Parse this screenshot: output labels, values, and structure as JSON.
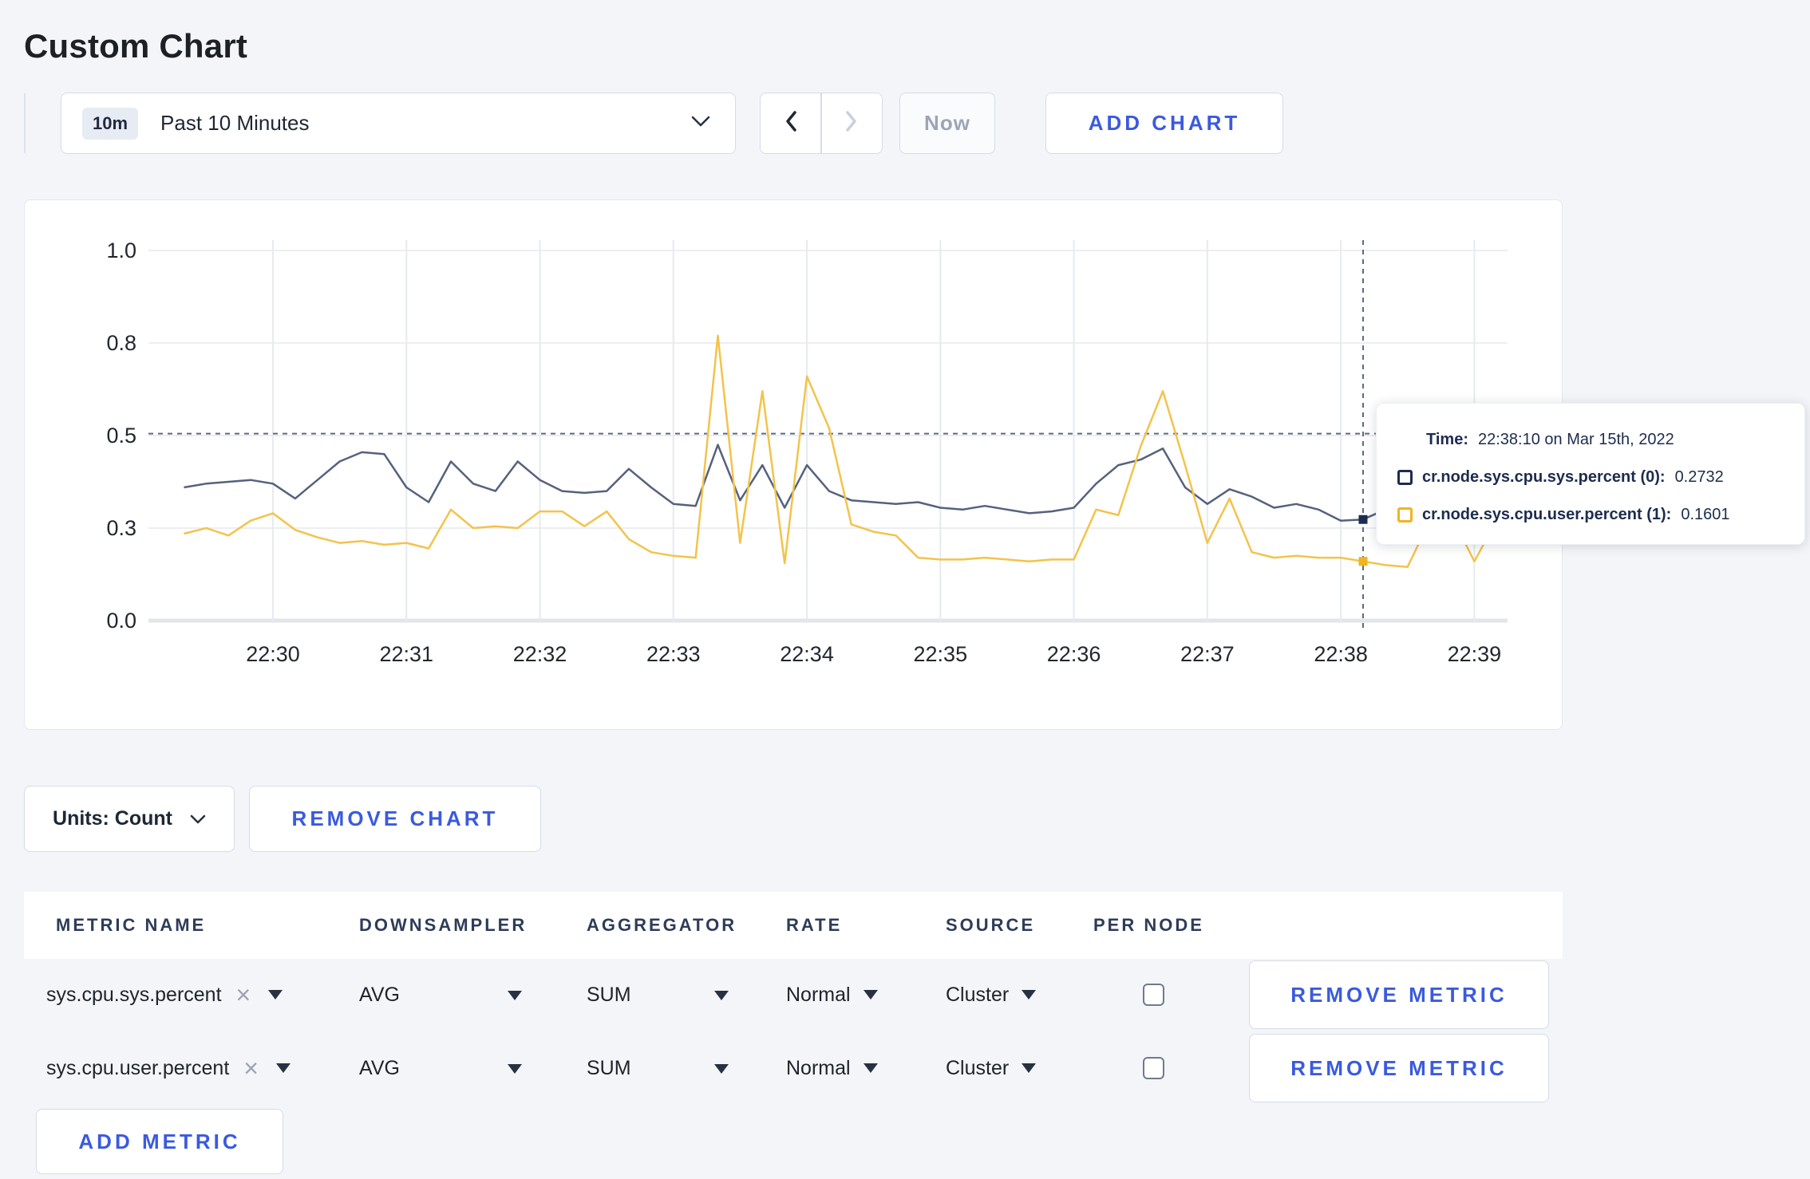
{
  "page": {
    "title": "Custom Chart"
  },
  "colors": {
    "accent_blue": "#3a5adf",
    "navy_text": "#1d2c4e",
    "page_background": "#f4f5f9",
    "series_sys_line": "#55627d",
    "series_user_line": "#f3c34a"
  },
  "toolbar": {
    "time_range_badge": "10m",
    "time_range_label": "Past 10 Minutes",
    "now_label": "Now",
    "add_chart_label": "ADD CHART"
  },
  "tooltip": {
    "time_label": "Time:",
    "time_value": "22:38:10 on Mar 15th, 2022",
    "series": [
      {
        "name": "cr.node.sys.cpu.sys.percent (0):",
        "value": "0.2732",
        "swatch_color": "#1d2c4e"
      },
      {
        "name": "cr.node.sys.cpu.user.percent (1):",
        "value": "0.1601",
        "swatch_color": "#f0b420"
      }
    ]
  },
  "chart_controls": {
    "units_label": "Units: Count",
    "remove_chart_label": "REMOVE CHART"
  },
  "metrics_table": {
    "headers": [
      "METRIC NAME",
      "DOWNSAMPLER",
      "AGGREGATOR",
      "RATE",
      "SOURCE",
      "PER NODE"
    ],
    "rows": [
      {
        "metric": "sys.cpu.sys.percent",
        "clear_icon": "×",
        "downsampler": "AVG",
        "aggregator": "SUM",
        "rate": "Normal",
        "source": "Cluster",
        "per_node_checked": false,
        "remove_label": "REMOVE METRIC"
      },
      {
        "metric": "sys.cpu.user.percent",
        "clear_icon": "×",
        "downsampler": "AVG",
        "aggregator": "SUM",
        "rate": "Normal",
        "source": "Cluster",
        "per_node_checked": false,
        "remove_label": "REMOVE METRIC"
      }
    ],
    "add_metric_label": "ADD METRIC"
  },
  "chart_data": {
    "type": "line",
    "title": "",
    "xlabel": "",
    "ylabel": "",
    "x_start": "22:29:20",
    "x_interval_seconds": 10,
    "x_tick_labels": [
      "22:30",
      "22:31",
      "22:32",
      "22:33",
      "22:34",
      "22:35",
      "22:36",
      "22:37",
      "22:38",
      "22:39"
    ],
    "x_first_tick_index": 4,
    "x_tick_every": 6,
    "y_ticks": [
      {
        "value": 0.0,
        "label": "0.0"
      },
      {
        "value": 0.25,
        "label": "0.3"
      },
      {
        "value": 0.5,
        "label": "0.5"
      },
      {
        "value": 0.75,
        "label": "0.8"
      },
      {
        "value": 1.0,
        "label": "1.0"
      }
    ],
    "ylim": [
      0,
      1
    ],
    "grid": true,
    "legend_position": "tooltip",
    "series": [
      {
        "name": "cr.node.sys.cpu.sys.percent",
        "color": "#55627d",
        "values": [
          0.36,
          0.37,
          0.375,
          0.38,
          0.37,
          0.33,
          0.38,
          0.43,
          0.455,
          0.45,
          0.36,
          0.32,
          0.43,
          0.37,
          0.35,
          0.43,
          0.38,
          0.35,
          0.345,
          0.35,
          0.41,
          0.36,
          0.315,
          0.31,
          0.475,
          0.325,
          0.42,
          0.305,
          0.42,
          0.35,
          0.325,
          0.32,
          0.315,
          0.32,
          0.305,
          0.3,
          0.31,
          0.3,
          0.29,
          0.295,
          0.305,
          0.37,
          0.42,
          0.435,
          0.465,
          0.36,
          0.315,
          0.355,
          0.335,
          0.305,
          0.315,
          0.3,
          0.27,
          0.2732,
          0.3,
          0.305,
          0.3,
          0.31,
          0.3,
          0.315
        ]
      },
      {
        "name": "cr.node.sys.cpu.user.percent",
        "color": "#f3c34a",
        "values": [
          0.235,
          0.25,
          0.23,
          0.27,
          0.29,
          0.245,
          0.225,
          0.21,
          0.215,
          0.205,
          0.21,
          0.195,
          0.3,
          0.25,
          0.255,
          0.25,
          0.295,
          0.295,
          0.255,
          0.295,
          0.22,
          0.185,
          0.175,
          0.17,
          0.77,
          0.21,
          0.62,
          0.155,
          0.66,
          0.52,
          0.26,
          0.24,
          0.23,
          0.17,
          0.165,
          0.165,
          0.17,
          0.165,
          0.16,
          0.165,
          0.165,
          0.3,
          0.285,
          0.47,
          0.62,
          0.42,
          0.21,
          0.33,
          0.185,
          0.17,
          0.175,
          0.17,
          0.17,
          0.1601,
          0.15,
          0.145,
          0.27,
          0.28,
          0.16,
          0.27
        ]
      }
    ],
    "crosshair": {
      "index": 53,
      "time": "22:38:10",
      "hline_value": 0.505,
      "point_values": [
        0.2732,
        0.1601
      ],
      "dot_colors": [
        "#1d2c4e",
        "#f0b420"
      ]
    }
  }
}
